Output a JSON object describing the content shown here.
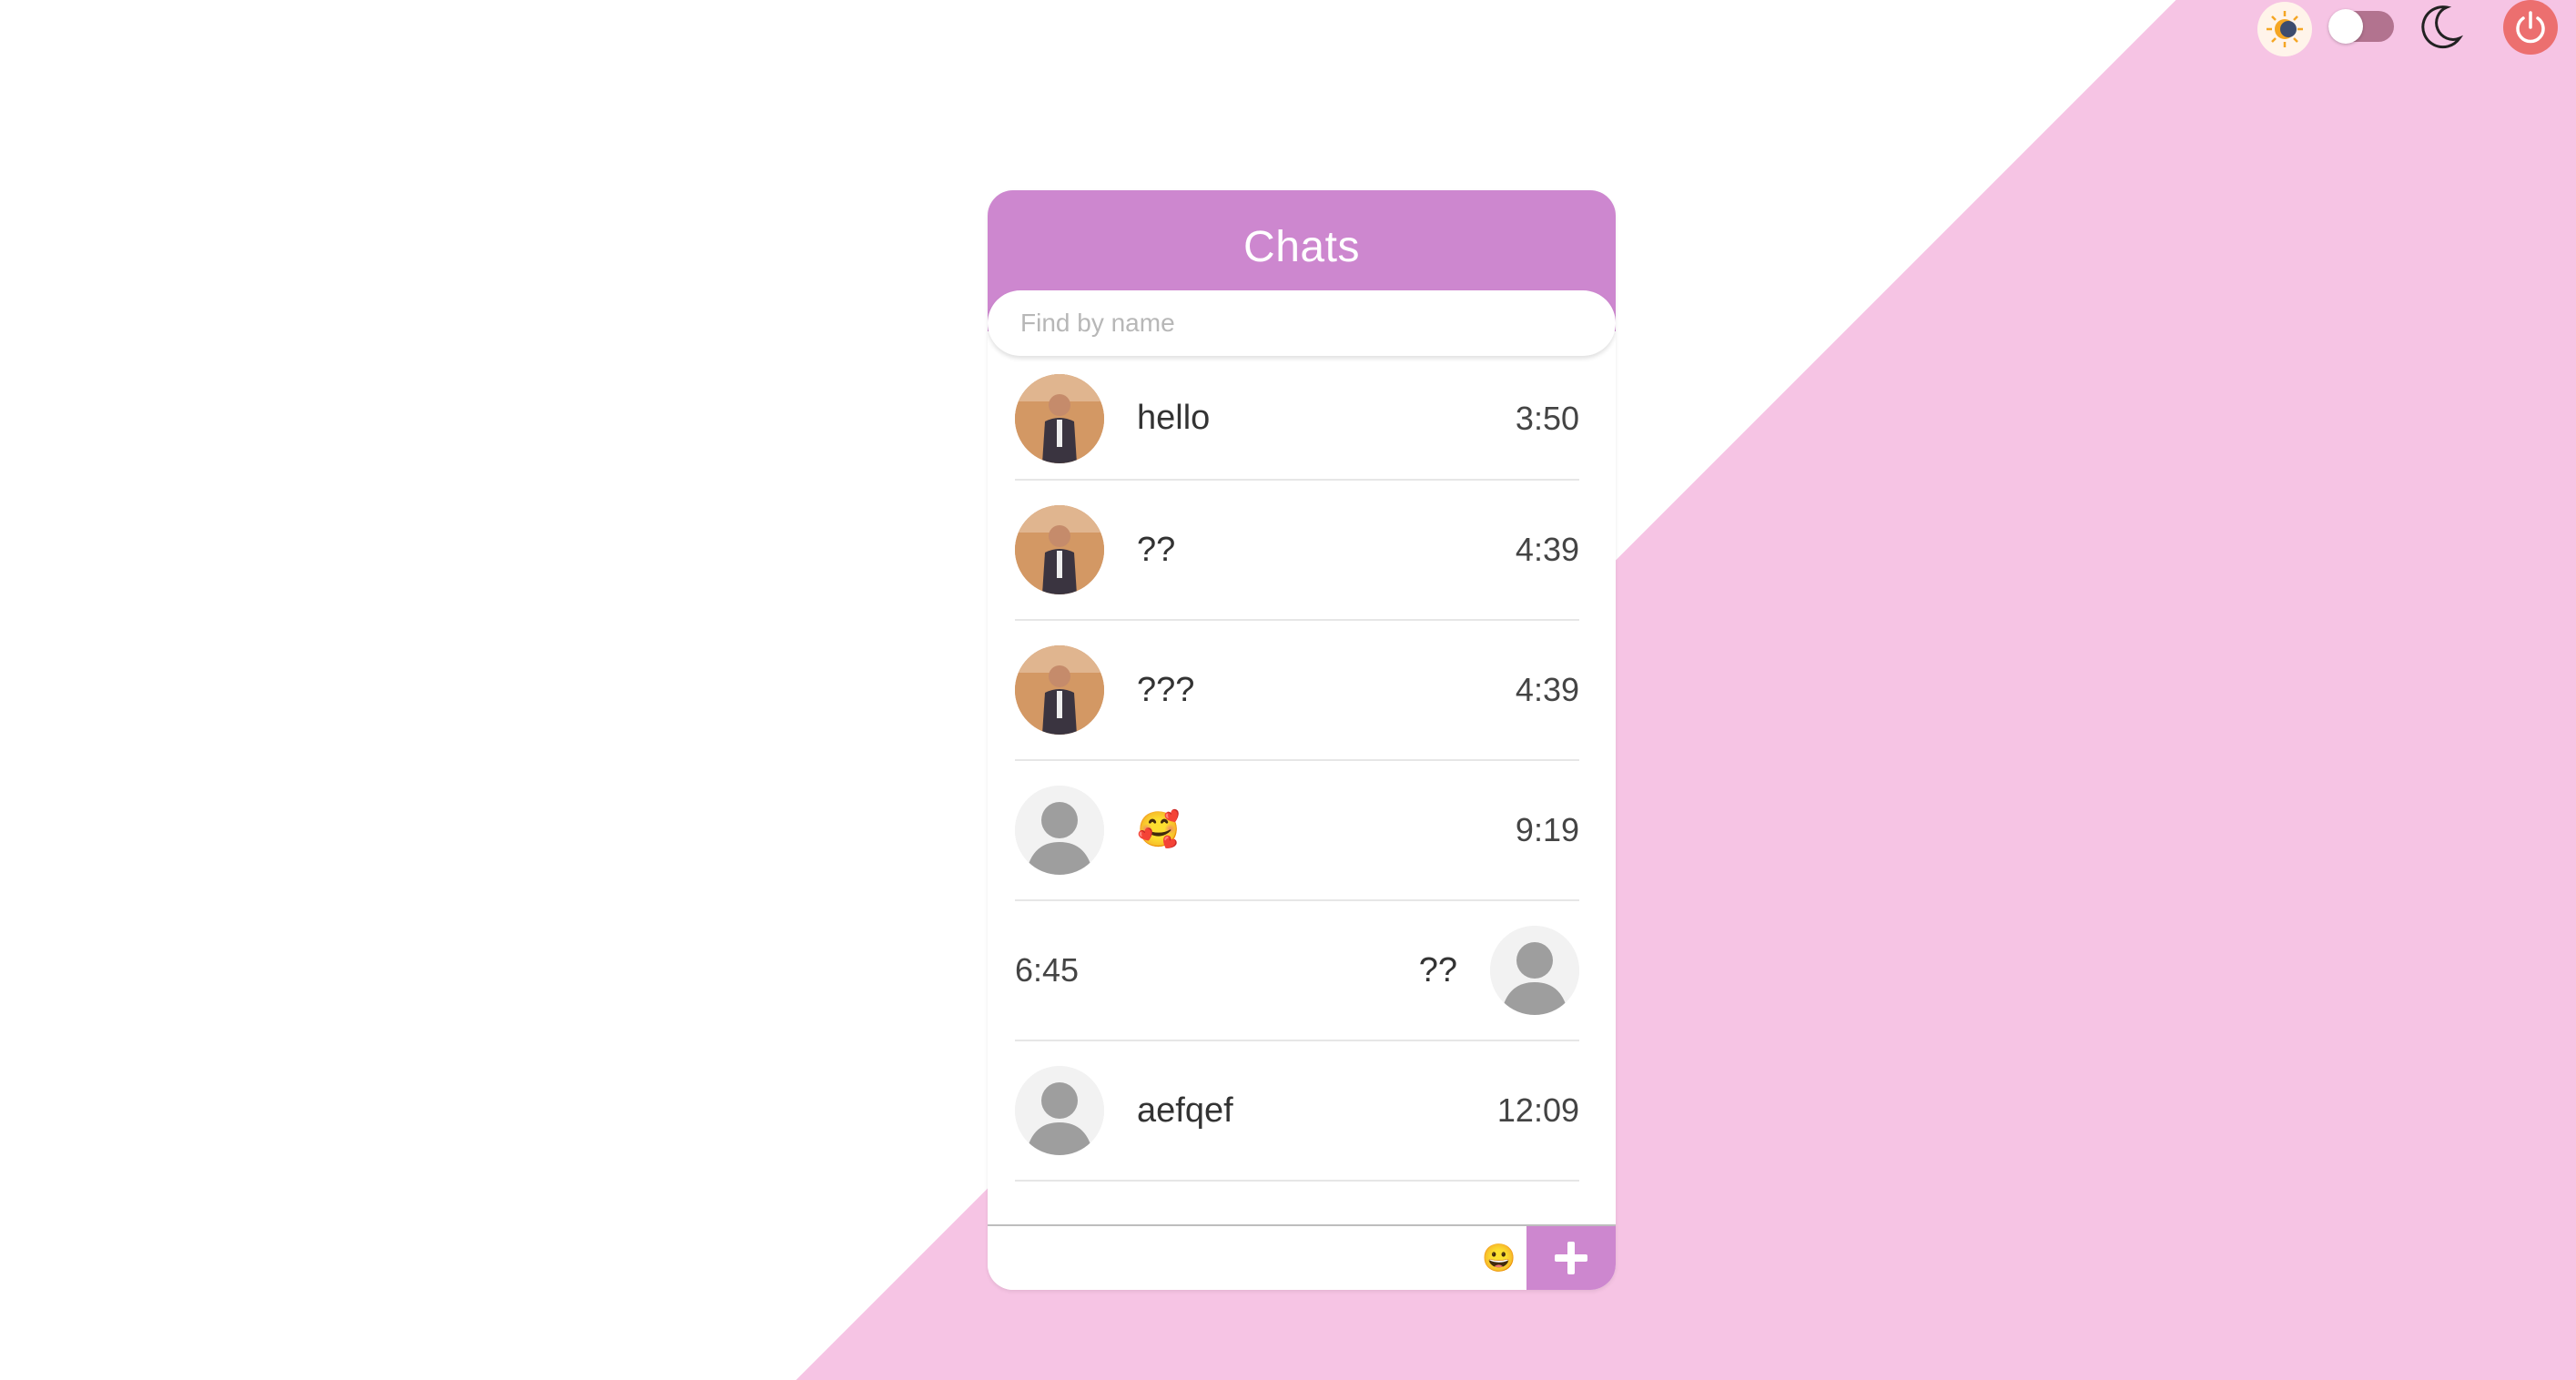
{
  "header": {
    "title": "Chats"
  },
  "search": {
    "placeholder": "Find by name"
  },
  "chats": [
    {
      "name": "hello",
      "time": "3:50",
      "avatar": "photo-avatar"
    },
    {
      "name": "??",
      "time": "4:39",
      "avatar": "photo-avatar"
    },
    {
      "name": "???",
      "time": "4:39",
      "avatar": "photo-avatar"
    },
    {
      "name": "🥰",
      "time": "9:19",
      "avatar": "default-avatar"
    },
    {
      "name": "??",
      "time": "6:45",
      "avatar": "default-avatar"
    },
    {
      "name": "aefqef",
      "time": "12:09",
      "avatar": "default-avatar"
    }
  ],
  "composer": {
    "value": "",
    "emoji": "😀"
  },
  "colors": {
    "accent": "#cd87cf",
    "background_pink": "#f6c4e4",
    "power": "#ec6f6f",
    "toggle": "#b2738f"
  },
  "icons": [
    "theme-icon",
    "toggle-switch",
    "moon-icon",
    "power-icon",
    "plus-icon",
    "emoji-icon"
  ]
}
